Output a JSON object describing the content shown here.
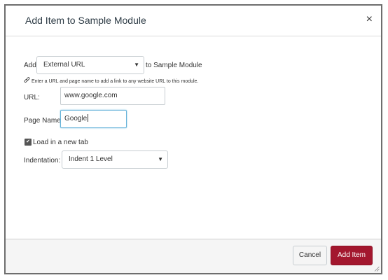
{
  "dialog": {
    "title": "Add Item to Sample Module",
    "close_label": "×"
  },
  "form": {
    "add_label": "Add",
    "item_type": {
      "selected": "External URL",
      "suffix": "to Sample Module"
    },
    "hint": "Enter a URL and page name to add a link to any website URL to this module.",
    "url": {
      "label": "URL:",
      "value": "www.google.com"
    },
    "page_name": {
      "label": "Page Name:",
      "value": "Google"
    },
    "new_tab": {
      "label": "Load in a new tab",
      "checked": true,
      "check_glyph": "✔"
    },
    "indentation": {
      "label": "Indentation:",
      "selected": "Indent 1 Level"
    }
  },
  "footer": {
    "cancel_label": "Cancel",
    "add_label": "Add Item"
  },
  "colors": {
    "primary_button": "#a3172e",
    "focus_border": "#66b3d9"
  },
  "icons": [
    "close-icon",
    "link-icon",
    "dropdown-arrow-icon",
    "checkbox-checked-icon",
    "resize-grip-icon"
  ]
}
